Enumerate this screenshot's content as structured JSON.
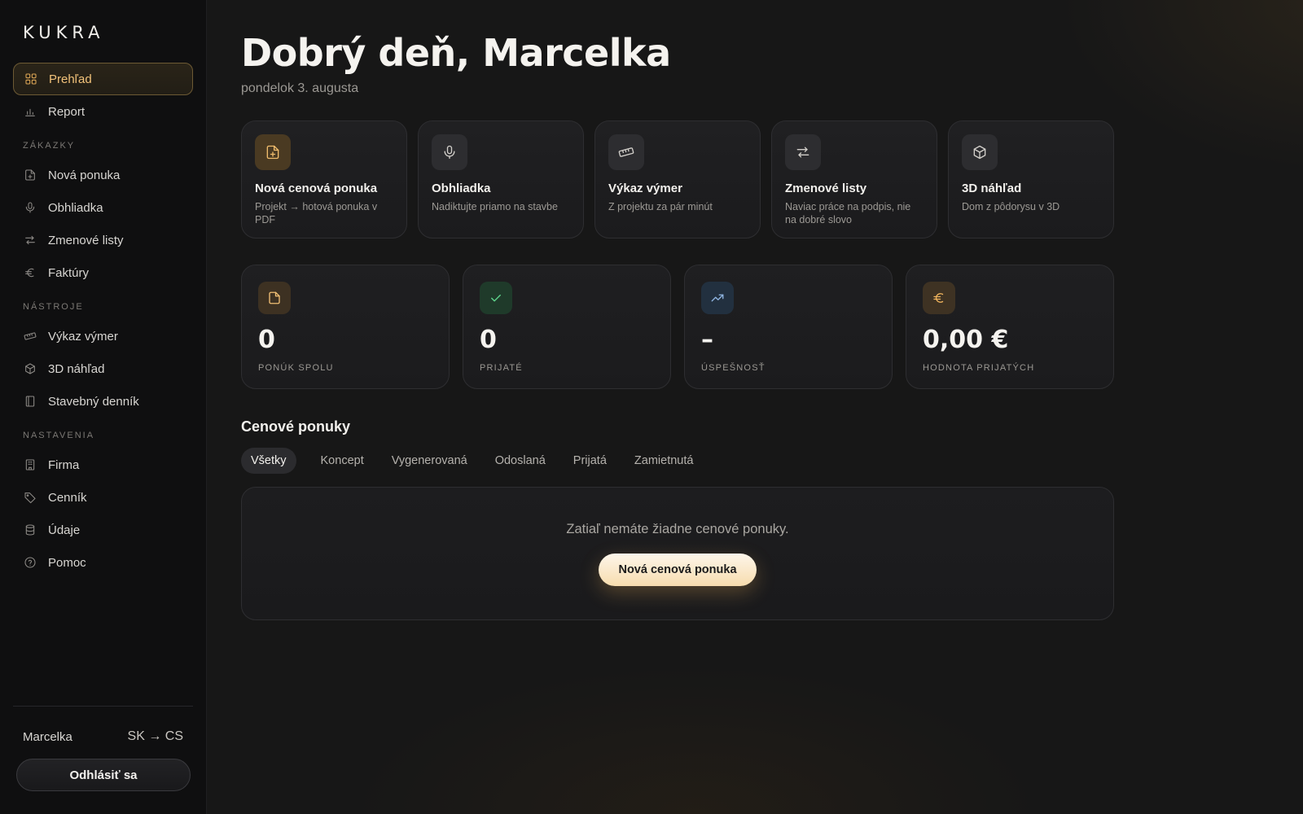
{
  "app": {
    "logo": "KUKRA"
  },
  "sidebar": {
    "top_items": [
      {
        "label": "Prehľad",
        "icon": "grid-icon",
        "active": true
      },
      {
        "label": "Report",
        "icon": "bar-chart-icon"
      }
    ],
    "sections": [
      {
        "label": "ZÁKAZKY",
        "items": [
          {
            "label": "Nová ponuka",
            "icon": "file-plus-icon"
          },
          {
            "label": "Obhliadka",
            "icon": "microphone-icon"
          },
          {
            "label": "Zmenové listy",
            "icon": "arrows-swap-icon"
          },
          {
            "label": "Faktúry",
            "icon": "euro-icon"
          }
        ]
      },
      {
        "label": "NÁSTROJE",
        "items": [
          {
            "label": "Výkaz výmer",
            "icon": "ruler-icon"
          },
          {
            "label": "3D náhľad",
            "icon": "cube-icon"
          },
          {
            "label": "Stavebný denník",
            "icon": "book-icon"
          }
        ]
      },
      {
        "label": "NASTAVENIA",
        "items": [
          {
            "label": "Firma",
            "icon": "building-icon"
          },
          {
            "label": "Cenník",
            "icon": "tag-icon"
          },
          {
            "label": "Údaje",
            "icon": "database-icon"
          },
          {
            "label": "Pomoc",
            "icon": "help-circle-icon"
          }
        ]
      }
    ],
    "footer": {
      "user": "Marcelka",
      "language_switch": "SK → CS",
      "logout_label": "Odhlásiť sa"
    }
  },
  "header": {
    "greeting": "Dobrý deň, Marcelka",
    "date": "pondelok 3. augusta"
  },
  "quick_actions": [
    {
      "title": "Nová cenová ponuka",
      "desc": "Projekt → hotová ponuka v PDF",
      "icon": "file-plus-icon",
      "accent": true
    },
    {
      "title": "Obhliadka",
      "desc": "Nadiktujte priamo na stavbe",
      "icon": "microphone-icon"
    },
    {
      "title": "Výkaz výmer",
      "desc": "Z projektu za pár minút",
      "icon": "ruler-icon"
    },
    {
      "title": "Zmenové listy",
      "desc": "Naviac práce na podpis, nie na dobré slovo",
      "icon": "arrows-swap-icon"
    },
    {
      "title": "3D náhľad",
      "desc": "Dom z pôdorysu v 3D",
      "icon": "cube-icon"
    }
  ],
  "stats": [
    {
      "value": "0",
      "label": "PONÚK SPOLU",
      "icon": "file-icon"
    },
    {
      "value": "0",
      "label": "PRIJATÉ",
      "icon": "check-icon"
    },
    {
      "value": "–",
      "label": "ÚSPEŠNOSŤ",
      "icon": "trending-up-icon"
    },
    {
      "value": "0,00 €",
      "label": "HODNOTA PRIJATÝCH",
      "icon": "euro-icon"
    }
  ],
  "offers": {
    "title": "Cenové ponuky",
    "tabs": [
      "Všetky",
      "Koncept",
      "Vygenerovaná",
      "Odoslaná",
      "Prijatá",
      "Zamietnutá"
    ],
    "active_tab": "Všetky",
    "empty_text": "Zatiaľ nemáte žiadne cenové ponuky.",
    "cta_label": "Nová cenová ponuka"
  },
  "colors": {
    "accent": "#f0bc6c",
    "active_border": "#6d5a34",
    "success": "#5ed58c",
    "info": "#8fb4e0"
  }
}
